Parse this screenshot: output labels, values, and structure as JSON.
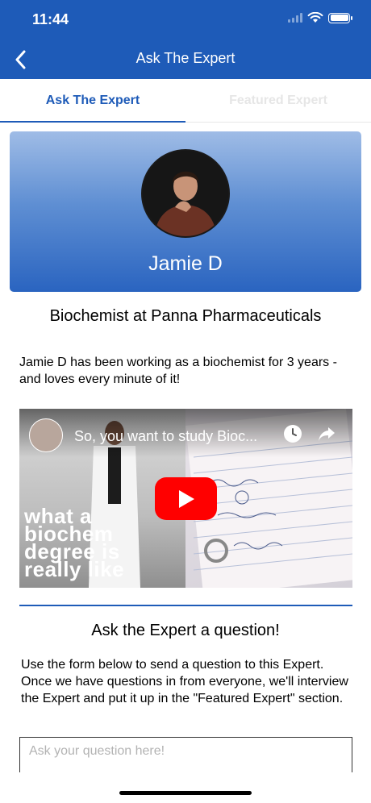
{
  "status_bar": {
    "time": "11:44"
  },
  "nav": {
    "title": "Ask The Expert",
    "back_icon": "chevron-left-icon"
  },
  "tabs": [
    {
      "label": "Ask The Expert",
      "active": true
    },
    {
      "label": "Featured Expert",
      "active": false
    }
  ],
  "expert": {
    "name": "Jamie D",
    "title": "Biochemist at Panna Pharmaceuticals",
    "bio": "Jamie D has been working as a biochemist for 3 years - and loves every minute of it!"
  },
  "video": {
    "title": "So, you want to study Bioc...",
    "overlay_text": "what a\nbiochem\ndegree is\nreally like"
  },
  "ask": {
    "title": "Ask the Expert a question!",
    "description": "Use the form below to send a question to this Expert. Once we have questions in from everyone, we'll interview the Expert and put it up in the \"Featured Expert\" section.",
    "placeholder": "Ask your question here!"
  },
  "colors": {
    "brand": "#1e5bb8",
    "play_button": "#ff0000"
  }
}
